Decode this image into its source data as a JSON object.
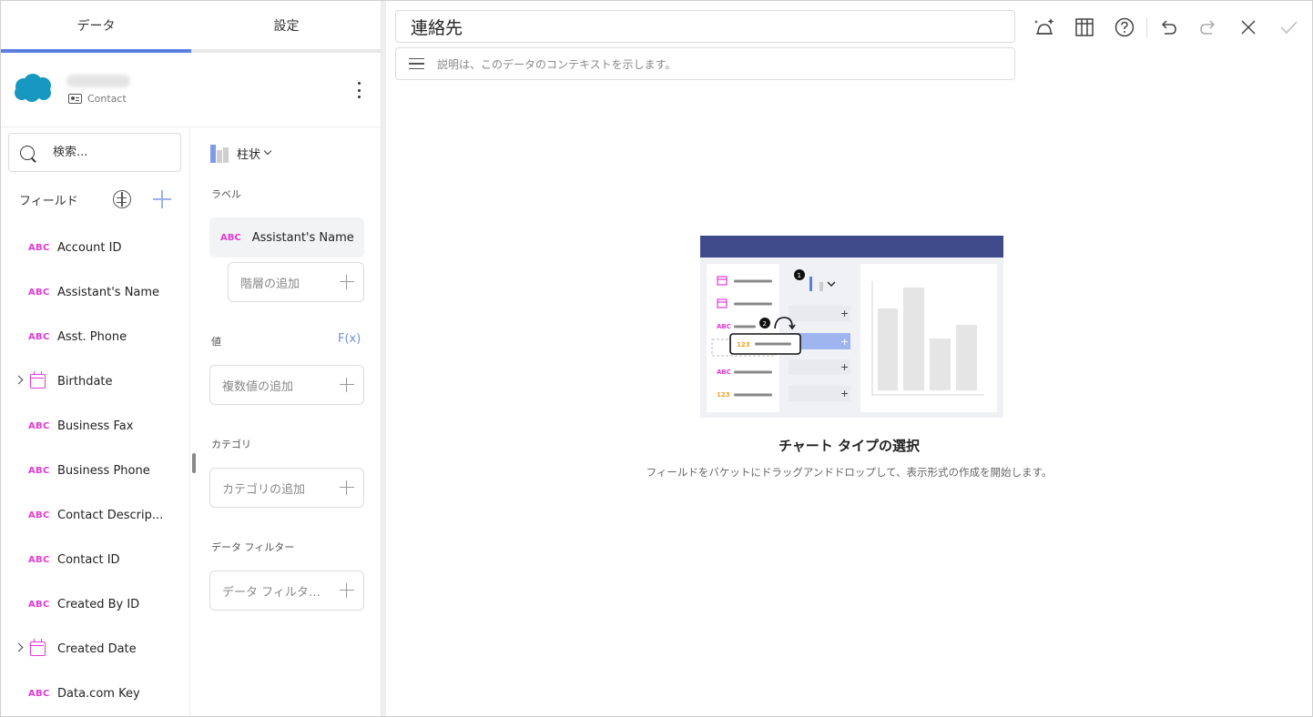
{
  "tabs": {
    "data_label": "データ",
    "settings_label": "設定"
  },
  "source": {
    "subtitle": "Contact"
  },
  "search": {
    "placeholder": "検索..."
  },
  "fields": {
    "title": "フィールド",
    "items": [
      {
        "type": "ABC",
        "name": "Account ID",
        "expandable": false
      },
      {
        "type": "ABC",
        "name": "Assistant's Name",
        "expandable": false
      },
      {
        "type": "ABC",
        "name": "Asst. Phone",
        "expandable": false
      },
      {
        "type": "date",
        "name": "Birthdate",
        "expandable": true
      },
      {
        "type": "ABC",
        "name": "Business Fax",
        "expandable": false
      },
      {
        "type": "ABC",
        "name": "Business Phone",
        "expandable": false
      },
      {
        "type": "ABC",
        "name": "Contact Descrip...",
        "expandable": false
      },
      {
        "type": "ABC",
        "name": "Contact ID",
        "expandable": false
      },
      {
        "type": "ABC",
        "name": "Created By ID",
        "expandable": false
      },
      {
        "type": "date",
        "name": "Created Date",
        "expandable": true
      },
      {
        "type": "ABC",
        "name": "Data.com Key",
        "expandable": false
      }
    ]
  },
  "buckets": {
    "chart_type_label": "柱状",
    "label_section": "ラベル",
    "label_field_type": "ABC",
    "label_field": "Assistant's Name",
    "add_hierarchy": "階層の追加",
    "values_section": "値",
    "fx_label": "F(x)",
    "add_values": "複数値の追加",
    "category_section": "カテゴリ",
    "add_category": "カテゴリの追加",
    "filter_section": "データ フィルター",
    "add_filter": "データ フィルターの追..."
  },
  "editor": {
    "title": "連絡先",
    "description_placeholder": "説明は、このデータのコンテキストを示します。"
  },
  "illustration": {
    "abc1": "ABC",
    "num1": "123",
    "abc2": "ABC",
    "num2": "123",
    "step1": "1",
    "step2": "2",
    "dragged": "123"
  },
  "empty_state": {
    "title": "チャート タイプの選択",
    "subtitle": "フィールドをバケットにドラッグアンドドロップして、表示形式の作成を開始します。"
  },
  "colors": {
    "accent": "#5b7fe0",
    "type_text": "#e23ad6",
    "type_number": "#f0a020",
    "salesforce": "#1798c1",
    "banner": "#3f4a8a"
  }
}
